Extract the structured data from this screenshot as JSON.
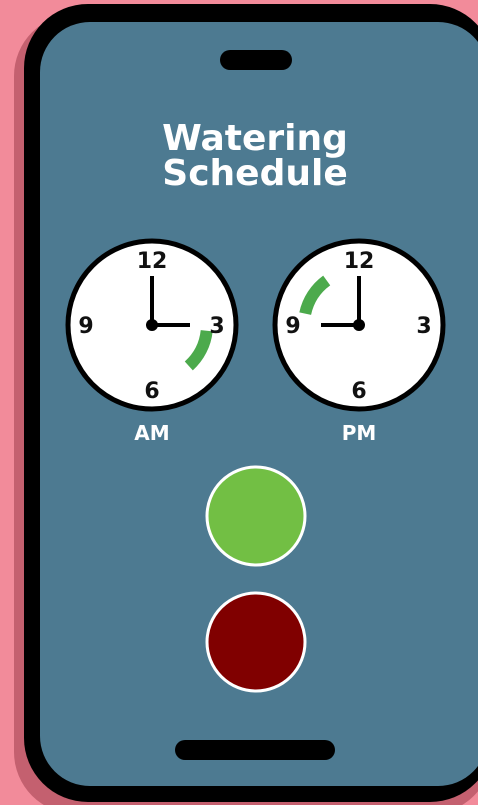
{
  "app": {
    "title_line1": "Watering",
    "title_line2": "Schedule"
  },
  "clocks": [
    {
      "label": "AM",
      "numbers": {
        "n12": "12",
        "n3": "3",
        "n6": "6",
        "n9": "9"
      },
      "time_shown": "3:00",
      "watering_window_minutes": [
        16,
        23
      ]
    },
    {
      "label": "PM",
      "numbers": {
        "n12": "12",
        "n3": "3",
        "n6": "6",
        "n9": "9"
      },
      "time_shown": "9:00",
      "watering_window_minutes": [
        47,
        54
      ]
    }
  ],
  "buttons": {
    "start": {
      "color": "#72bf44"
    },
    "stop": {
      "color": "#800000"
    }
  },
  "colors": {
    "background": "#f28b9a",
    "phone_body": "#000000",
    "screen": "#4d7a91",
    "arc": "#4caa4c"
  }
}
